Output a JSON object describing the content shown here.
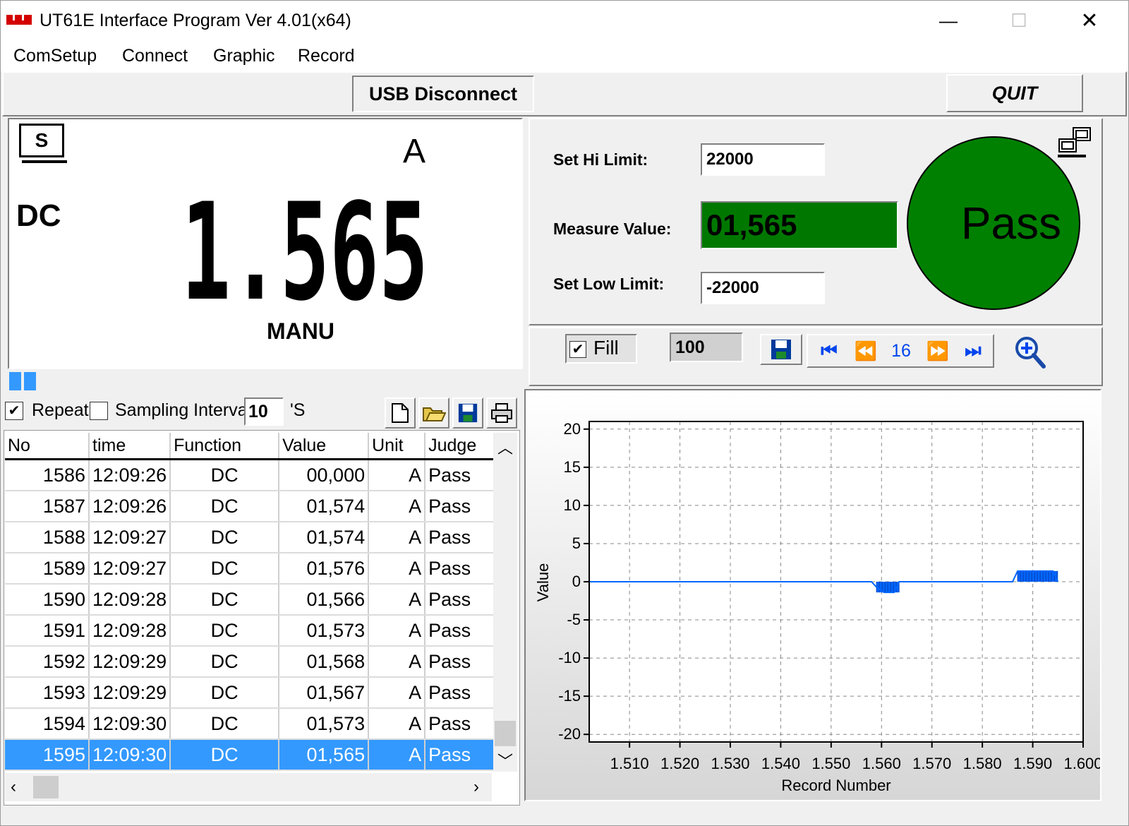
{
  "window": {
    "title": "UT61E Interface Program Ver 4.01(x64)",
    "minimize_glyph": "—",
    "maximize_glyph": "☐",
    "close_glyph": "✕"
  },
  "menu": [
    "ComSetup",
    "Connect",
    "Graphic",
    "Record"
  ],
  "toolbar": {
    "usb_button": "USB Disconnect",
    "quit_button": "QUIT"
  },
  "meter": {
    "s_badge": "S",
    "mode": "DC",
    "unit": "A",
    "display_value": "1.565",
    "range_mode": "MANU"
  },
  "limits": {
    "hi_label": "Set Hi Limit:",
    "hi_value": "22000",
    "measure_label": "Measure Value:",
    "measure_value": "01,565",
    "low_label": "Set Low Limit:",
    "low_value": "-22000",
    "result": "Pass",
    "result_color": "#008000",
    "measure_bg": "#007800"
  },
  "graph_controls": {
    "fill_label": "Fill",
    "fill_checked": true,
    "points_value": "100",
    "page_number": "16"
  },
  "record_controls": {
    "repeat_label": "Repeat",
    "repeat_checked": true,
    "sampling_checked": false,
    "sampling_label": "Sampling Interval",
    "interval_value": "10",
    "interval_unit": "'S"
  },
  "table": {
    "headers": [
      "No",
      "time",
      "Function",
      "Value",
      "Unit",
      "Judge"
    ],
    "rows": [
      [
        "1586",
        "12:09:26",
        "DC",
        "00,000",
        "A",
        "Pass"
      ],
      [
        "1587",
        "12:09:26",
        "DC",
        "01,574",
        "A",
        "Pass"
      ],
      [
        "1588",
        "12:09:27",
        "DC",
        "01,574",
        "A",
        "Pass"
      ],
      [
        "1589",
        "12:09:27",
        "DC",
        "01,576",
        "A",
        "Pass"
      ],
      [
        "1590",
        "12:09:28",
        "DC",
        "01,566",
        "A",
        "Pass"
      ],
      [
        "1591",
        "12:09:28",
        "DC",
        "01,573",
        "A",
        "Pass"
      ],
      [
        "1592",
        "12:09:29",
        "DC",
        "01,568",
        "A",
        "Pass"
      ],
      [
        "1593",
        "12:09:29",
        "DC",
        "01,567",
        "A",
        "Pass"
      ],
      [
        "1594",
        "12:09:30",
        "DC",
        "01,573",
        "A",
        "Pass"
      ],
      [
        "1595",
        "12:09:30",
        "DC",
        "01,565",
        "A",
        "Pass"
      ]
    ],
    "selected_index": 9
  },
  "chart_data": {
    "type": "line",
    "xlabel": "Record Number",
    "ylabel": "Value",
    "xlim": [
      1.502,
      1.6
    ],
    "ylim": [
      -21,
      21
    ],
    "x_ticks": [
      "1.510",
      "1.520",
      "1.530",
      "1.540",
      "1.550",
      "1.560",
      "1.570",
      "1.580",
      "1.590",
      "1.600"
    ],
    "x_tick_values": [
      1.51,
      1.52,
      1.53,
      1.54,
      1.55,
      1.56,
      1.57,
      1.58,
      1.59,
      1.6
    ],
    "y_ticks": [
      20,
      15,
      10,
      5,
      0,
      -5,
      -10,
      -15,
      -20
    ],
    "grid": true,
    "series_color": "#0066ff",
    "series": [
      {
        "x": [
          1.502,
          1.558,
          1.559,
          1.5605,
          1.5625,
          1.5635,
          1.586,
          1.587,
          1.5885,
          1.594,
          1.595
        ],
        "y": [
          0,
          0,
          -0.7,
          -1.4,
          -1.4,
          0,
          0,
          1.4,
          1.4,
          1.4,
          0
        ]
      }
    ],
    "fill_regions": [
      {
        "x_start": 1.559,
        "x_end": 1.5635,
        "y": -1.4
      },
      {
        "x_start": 1.587,
        "x_end": 1.595,
        "y": 1.4
      }
    ]
  }
}
